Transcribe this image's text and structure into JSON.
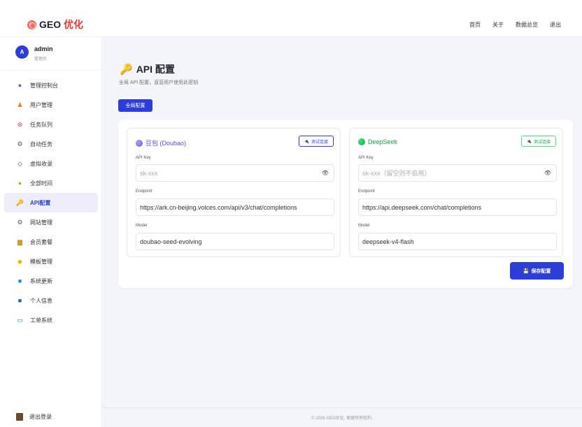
{
  "brand": {
    "name_prefix": "GEO",
    "name_suffix": "优化"
  },
  "topnav": [
    "首页",
    "关于",
    "数据总览",
    "退出"
  ],
  "user": {
    "avatar_letter": "A",
    "name": "admin",
    "role": "管理员"
  },
  "sidebar": {
    "items": [
      {
        "label": "管理控制台",
        "icon": "dashboard-icon",
        "symbol": "●",
        "color": "#7b4fc9"
      },
      {
        "label": "用户管理",
        "icon": "users-icon",
        "symbol": "♟",
        "color": "#e67e22"
      },
      {
        "label": "任务队列",
        "icon": "queue-icon",
        "symbol": "⊜",
        "color": "#d63031"
      },
      {
        "label": "自动任务",
        "icon": "gear-icon",
        "symbol": "⚙",
        "color": "#555555"
      },
      {
        "label": "虚拟收录",
        "icon": "diamond-icon",
        "symbol": "◇",
        "color": "#444444"
      },
      {
        "label": "全部时间",
        "icon": "money-bag-icon",
        "symbol": "●",
        "color": "#d4a017"
      },
      {
        "label": "API配置",
        "icon": "key-icon",
        "symbol": "🔑",
        "color": "#e6a117",
        "active": true
      },
      {
        "label": "网站管理",
        "icon": "settings-icon",
        "symbol": "⚙",
        "color": "#555555"
      },
      {
        "label": "会员套餐",
        "icon": "package-icon",
        "symbol": "▆",
        "color": "#c99a2e"
      },
      {
        "label": "模板管理",
        "icon": "template-icon",
        "symbol": "◆",
        "color": "#e6b800"
      },
      {
        "label": "系统更新",
        "icon": "update-icon",
        "symbol": "■",
        "color": "#1e88e5"
      },
      {
        "label": "个人信息",
        "icon": "profile-icon",
        "symbol": "■",
        "color": "#1565c0"
      },
      {
        "label": "工单系统",
        "icon": "ticket-icon",
        "symbol": "▭",
        "color": "#0d8ac9"
      }
    ],
    "logout_label": "退出登录"
  },
  "page": {
    "title": "API 配置",
    "subtitle": "全局 API 配置，直营用户使用此密钥",
    "global_button": "全局配置",
    "save_button": "保存配置"
  },
  "cards": [
    {
      "name": "豆包 (Doubao)",
      "color": "#6c5ce7",
      "test_button": "测试连接",
      "api_key_label": "API Key",
      "api_key_placeholder": "sk-xxx",
      "endpoint_label": "Endpoint",
      "endpoint_value": "https://ark.cn-beijing.volces.com/api/v3/chat/completions",
      "model_label": "Model",
      "model_value": "doubao-seed-evolving"
    },
    {
      "name": "DeepSeek",
      "color": "#16a34a",
      "test_button": "测试连接",
      "api_key_label": "API Key",
      "api_key_placeholder": "sk-xxx（留空则不启用）",
      "endpoint_label": "Endpoint",
      "endpoint_value": "https://api.deepseek.com/chat/completions",
      "model_label": "Model",
      "model_value": "deepseek-v4-flash"
    }
  ],
  "footer": "© 2026 GEO优化. 保留所有权利."
}
